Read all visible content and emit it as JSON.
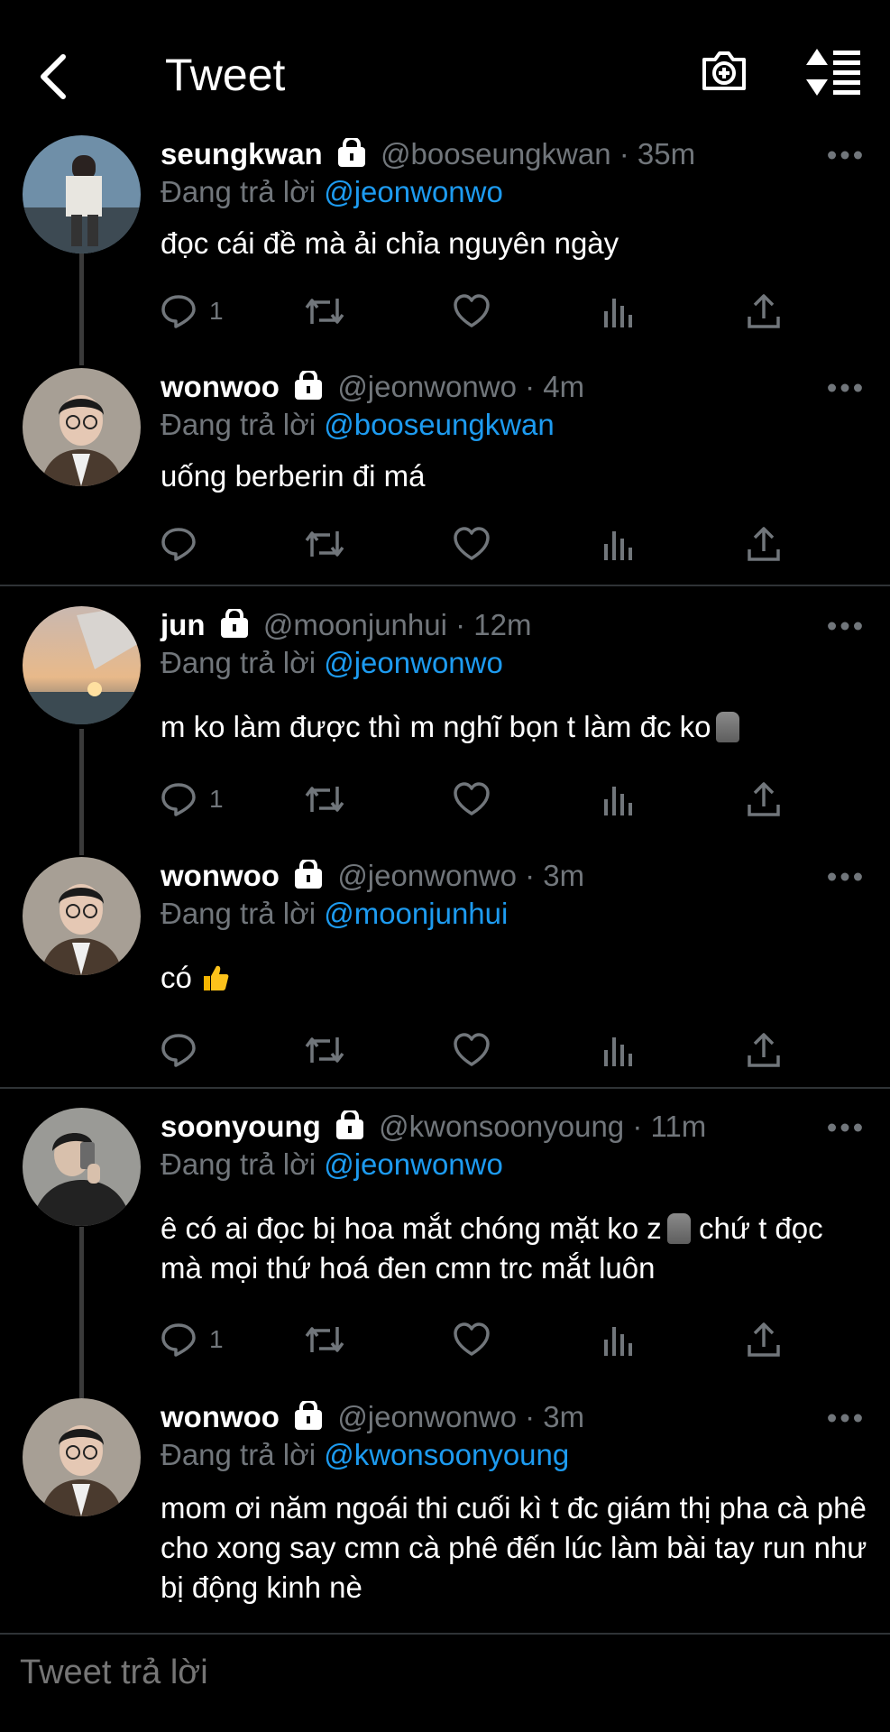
{
  "header": {
    "title": "Tweet",
    "back_icon": "chevron-left-icon",
    "camera_icon": "camera-plus-icon",
    "sort_icon": "sort-list-icon"
  },
  "tweets": [
    {
      "name": "seungkwan",
      "handle": "@booseungkwan",
      "time": "35m",
      "reply_prefix": "Đang trả lời",
      "reply_to": "@jeonwonwo",
      "text": "đọc cái đề mà ải chỉa nguyên ngày",
      "replies": "1"
    },
    {
      "name": "wonwoo",
      "handle": "@jeonwonwo",
      "time": "4m",
      "reply_prefix": "Đang trả lời",
      "reply_to": "@booseungkwan",
      "text": "uống berberin đi má",
      "replies": ""
    },
    {
      "name": "jun",
      "handle": "@moonjunhui",
      "time": "12m",
      "reply_prefix": "Đang trả lời",
      "reply_to": "@jeonwonwo",
      "text": "m ko làm được thì m nghĩ bọn t làm đc ko",
      "replies": "1"
    },
    {
      "name": "wonwoo",
      "handle": "@jeonwonwo",
      "time": "3m",
      "reply_prefix": "Đang trả lời",
      "reply_to": "@moonjunhui",
      "text": "có",
      "replies": ""
    },
    {
      "name": "soonyoung",
      "handle": "@kwonsoonyoung",
      "time": "11m",
      "reply_prefix": "Đang trả lời",
      "reply_to": "@jeonwonwo",
      "text_a": "ê có ai đọc bị hoa mắt chóng mặt ko z",
      "text_b": "chứ t đọc mà mọi thứ hoá đen cmn trc mắt luôn",
      "replies": "1"
    },
    {
      "name": "wonwoo",
      "handle": "@jeonwonwo",
      "time": "3m",
      "reply_prefix": "Đang trả lời",
      "reply_to": "@kwonsoonyoung",
      "text": "mom ơi năm ngoái thi cuối kì t đc giám thị pha cà phê cho xong say cmn cà phê đến lúc làm bài tay run như bị động kinh nè",
      "replies": ""
    }
  ],
  "reply_bar": {
    "placeholder": "Tweet trả lời"
  },
  "colors": {
    "accent": "#1d9bf0",
    "muted": "#71767b",
    "background": "#000000"
  }
}
